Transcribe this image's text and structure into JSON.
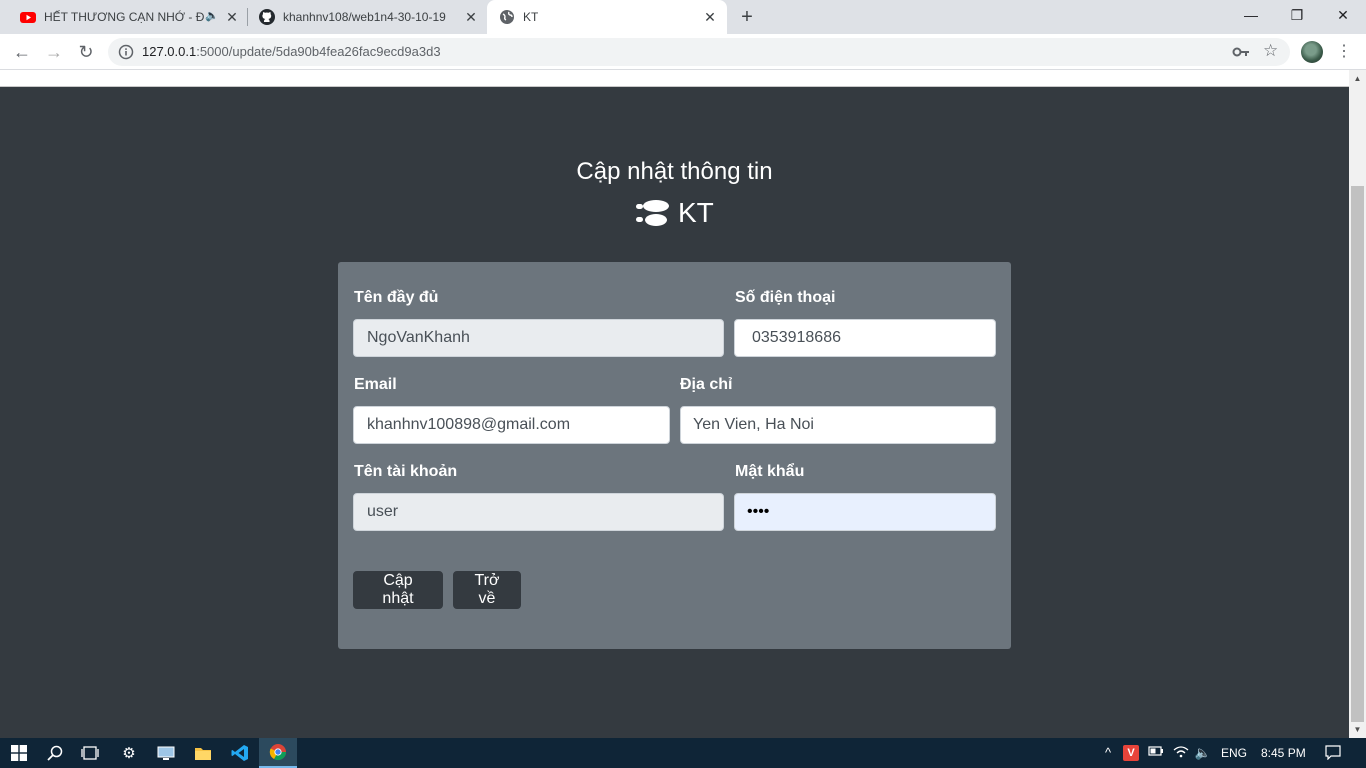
{
  "browser": {
    "tabs": [
      {
        "title": "HẾT THƯƠNG CẠN NHỚ - Đ",
        "icon": "youtube-icon",
        "audio": true
      },
      {
        "title": "khanhnv108/web1n4-30-10-19",
        "icon": "github-icon"
      },
      {
        "title": "KT",
        "icon": "globe-icon",
        "active": true
      }
    ],
    "close_glyph": "✕",
    "newtab_glyph": "+",
    "window": {
      "minimize": "—",
      "restore": "❐",
      "close": "✕"
    },
    "url": {
      "host": "127.0.0.1",
      "rest": ":5000/update/5da90b4fea26fac9ecd9a3d3"
    },
    "nav": {
      "back": "←",
      "forward": "→",
      "reload": "↻"
    },
    "star": "☆",
    "menu": "⋮"
  },
  "page": {
    "title": "Cập nhật thông tin",
    "brand": "KT",
    "form": {
      "fullname": {
        "label": "Tên đầy đủ",
        "value": "NgoVanKhanh"
      },
      "phone": {
        "label": "Số điện thoại",
        "value": "0353918686"
      },
      "email": {
        "label": "Email",
        "value": "khanhnv100898@gmail.com"
      },
      "address": {
        "label": "Địa chỉ",
        "value": "Yen Vien, Ha Noi"
      },
      "username": {
        "label": "Tên tài khoản",
        "value": "user"
      },
      "password": {
        "label": "Mật khẩu",
        "value": "1234"
      }
    },
    "buttons": {
      "update": "Cập nhật",
      "back": "Trở về"
    }
  },
  "taskbar": {
    "language": "ENG",
    "time": "8:45 PM"
  },
  "colors": {
    "page_bg": "#343a40",
    "card_bg": "#6c757d",
    "button_bg": "#343a40",
    "taskbar_bg": "#0f2537"
  }
}
